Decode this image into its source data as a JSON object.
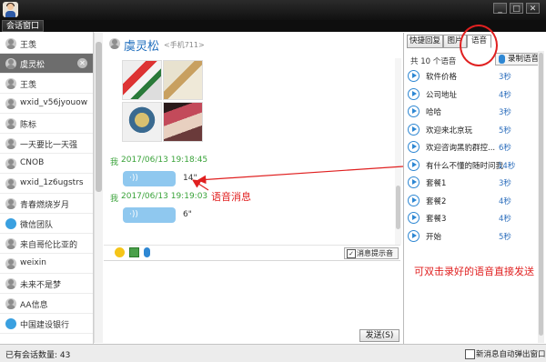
{
  "window": {
    "tab_label": "会话窗口",
    "buttons": {
      "minimize": "_",
      "maximize": "□",
      "close": "✕"
    }
  },
  "contacts": {
    "items": [
      {
        "name": "王羡",
        "icon": "person-icon",
        "selected": false
      },
      {
        "name": "虞灵松",
        "icon": "person-icon",
        "selected": true
      },
      {
        "name": "王羡",
        "icon": "person-icon",
        "selected": false
      },
      {
        "name": "wxid_v56jyouow",
        "icon": "person-icon",
        "selected": false
      },
      {
        "name": "陈标",
        "icon": "person-icon",
        "selected": false
      },
      {
        "name": "一天要比一天强",
        "icon": "person-icon",
        "selected": false
      },
      {
        "name": "CNOB",
        "icon": "person-icon",
        "selected": false
      },
      {
        "name": "wxid_1z6ugstrs",
        "icon": "person-icon",
        "selected": false
      },
      {
        "name": "青春燃烧岁月",
        "icon": "person-icon",
        "selected": false
      },
      {
        "name": "微信团队",
        "icon": "group-icon",
        "selected": false
      },
      {
        "name": "来自哥伦比亚的",
        "icon": "person-icon",
        "selected": false
      },
      {
        "name": "weixin",
        "icon": "person-icon",
        "selected": false
      },
      {
        "name": "未来不是梦",
        "icon": "person-icon",
        "selected": false
      },
      {
        "name": "AA信息",
        "icon": "person-icon",
        "selected": false
      },
      {
        "name": "中国建设银行",
        "icon": "group-icon",
        "selected": false
      }
    ],
    "close_glyph": "✕"
  },
  "chat": {
    "contact_name": "虞灵松",
    "contact_sub": "<手机711>",
    "messages": [
      {
        "sender": "我",
        "time": "2017/06/13 19:18:45",
        "duration": "14\""
      },
      {
        "sender": "我",
        "time": "2017/06/13 19:19:03",
        "duration": "6\""
      }
    ],
    "bubble_glyph": "·))",
    "toolbar": {
      "prompt_label": "消息提示音",
      "prompt_checked": true,
      "check_glyph": "✓"
    },
    "send_label": "发送(S)"
  },
  "right_panel": {
    "tabs": [
      "快捷回复",
      "图片",
      "语音"
    ],
    "active_tab": 2,
    "count_label": "共 10 个语音",
    "record_label": "录制语音",
    "voices": [
      {
        "label": "软件价格",
        "duration": "3秒"
      },
      {
        "label": "公司地址",
        "duration": "4秒"
      },
      {
        "label": "哈哈",
        "duration": "3秒"
      },
      {
        "label": "欢迎来北京玩",
        "duration": "5秒"
      },
      {
        "label": "欢迎咨询黑豹群控...",
        "duration": "6秒"
      },
      {
        "label": "有什么不懂的随时问我",
        "duration": "14秒"
      },
      {
        "label": "套餐1",
        "duration": "3秒"
      },
      {
        "label": "套餐2",
        "duration": "4秒"
      },
      {
        "label": "套餐3",
        "duration": "4秒"
      },
      {
        "label": "开始",
        "duration": "5秒"
      }
    ]
  },
  "annotations": {
    "voice_msg": "语音消息",
    "double_click_hint": "可双击录好的语音直接发送"
  },
  "status": {
    "session_count": "已有会话数量: 43",
    "popup_label": "新消息自动弹出窗口",
    "popup_checked": false
  },
  "colors": {
    "accent_blue": "#2e87d3",
    "annotation_red": "#e02020",
    "timestamp_green": "#3aa33a",
    "bubble_blue": "#8fc8ef"
  }
}
